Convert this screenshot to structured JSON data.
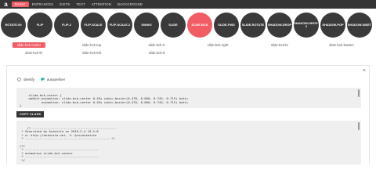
{
  "logo": "a",
  "nav": [
    "BASIC",
    "ENTRANCES",
    "EXITS",
    "TEXT",
    "ATTENTION",
    "BACKGROUND"
  ],
  "circles": [
    "ROTATE-90",
    "FLIP",
    "FLIP-2",
    "FLIP-SCALE",
    "FLIP-SCALE-2",
    "SWING",
    "SLIDE",
    "SLIDE-BCK",
    "SLIDE-FWD",
    "SLIDE-ROTATE",
    "SHADOW-DROP",
    "SHADOW-DROP-2",
    "SHADOW-POP",
    "SHADOW-INSET"
  ],
  "sublist": {
    "row1": [
      "slide-bck-center",
      "slide-bck-top",
      "slide-bck-tr",
      "slide-bck-right",
      "slide-bck-br",
      "slide-bck-bottom"
    ],
    "row2": [
      "slide-bck-bl",
      "slide-bck-left",
      "slide-bck-tl"
    ]
  },
  "panel": {
    "close": "×",
    "radio1": "identify",
    "radio2": "autoprefixer",
    "code1": ".slide-bck-center {\n    -webkit-animation: slide-bck-center 0.45s cubic-bezier(0.470, 0.000, 0.745, 0.715) both;\n            animation: slide-bck-center 0.45s cubic-bezier(0.470, 0.000, 0.745, 0.715) both;\n}",
    "copy": "COPY CLASS",
    "code2": "/* ----------------------------------------------\n * Generated by Animista on 2019-2-4 15:1:6\n * w: http://animista.net, t: @cssanimista\n * ---------------------------------------------- */\n\n/**\n * ----------------------------------------\n * animation slide-bck-center\n * ----------------------------------------\n */"
  }
}
